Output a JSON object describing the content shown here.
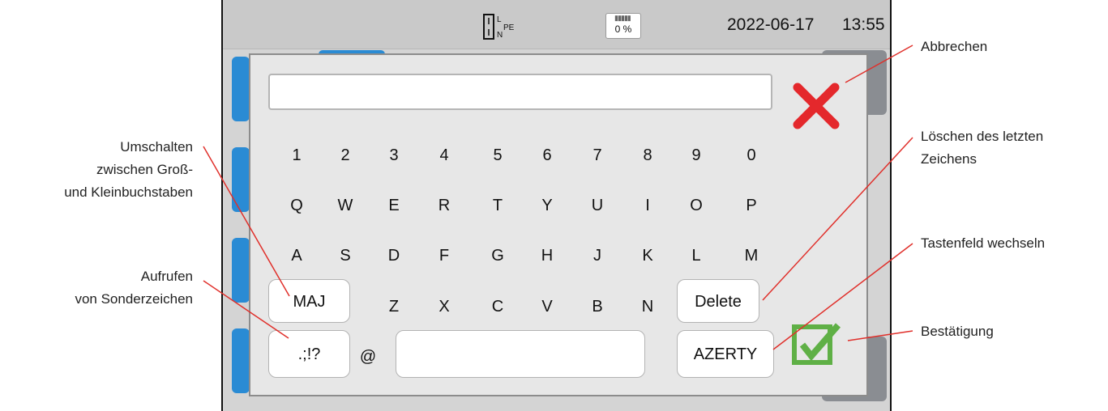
{
  "statusbar": {
    "date": "2022-06-17",
    "time": "13:55",
    "sd_percent": "0 %",
    "conn_labels": [
      "L",
      "N",
      "PE"
    ]
  },
  "input": {
    "value": ""
  },
  "keyboard": {
    "row_digits": [
      "1",
      "2",
      "3",
      "4",
      "5",
      "6",
      "7",
      "8",
      "9",
      "0"
    ],
    "row_q": [
      "Q",
      "W",
      "E",
      "R",
      "T",
      "Y",
      "U",
      "I",
      "O",
      "P"
    ],
    "row_a": [
      "A",
      "S",
      "D",
      "F",
      "G",
      "H",
      "J",
      "K",
      "L",
      "M"
    ],
    "row_z": [
      "Z",
      "X",
      "C",
      "V",
      "B",
      "N"
    ],
    "maj_label": "MAJ",
    "delete_label": "Delete",
    "special_label": ".;!?",
    "at_label": "@",
    "layout_label": "AZERTY"
  },
  "annotations": {
    "cancel": "Abbrechen",
    "delete": "Löschen des letzten Zeichens",
    "delete_line1": "Löschen des letzten",
    "delete_line2": "Zeichens",
    "layout": "Tastenfeld wechseln",
    "confirm": "Bestätigung",
    "shift_line1": "Umschalten",
    "shift_line2": "zwischen Groß-",
    "shift_line3": "und Kleinbuchstaben",
    "special_line1": "Aufrufen",
    "special_line2": "von Sonderzeichen"
  },
  "colors": {
    "annotation_line": "#e0302b",
    "cancel_red": "#e4282c",
    "confirm_green": "#5fb046",
    "tab_blue": "#2a8bd4"
  },
  "icons": {
    "cancel": "close-x-icon",
    "confirm": "checkbox-check-icon",
    "connection": "connection-terminals-icon",
    "sd": "sd-card-icon"
  }
}
